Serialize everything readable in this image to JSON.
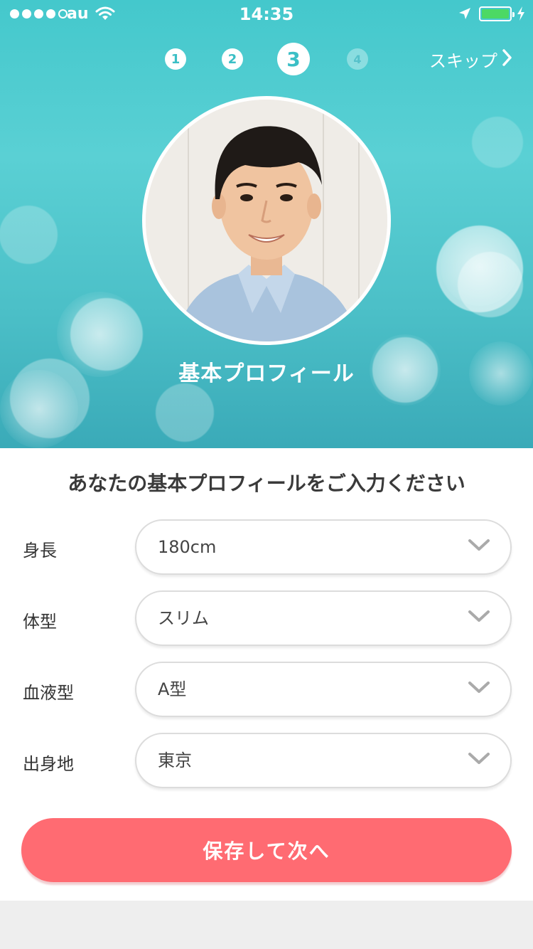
{
  "status_bar": {
    "carrier": "au",
    "time": "14:35",
    "signal_dots_filled": 4,
    "battery_color": "#4cd964"
  },
  "steps": [
    {
      "label": "1",
      "state": "done"
    },
    {
      "label": "2",
      "state": "done"
    },
    {
      "label": "3",
      "state": "current"
    },
    {
      "label": "4",
      "state": "todo"
    }
  ],
  "skip": {
    "label": "スキップ"
  },
  "hero": {
    "title": "基本プロフィール"
  },
  "form": {
    "heading": "あなたの基本プロフィールをご入力ください",
    "fields": [
      {
        "label": "身長",
        "value": "180cm"
      },
      {
        "label": "体型",
        "value": "スリム"
      },
      {
        "label": "血液型",
        "value": "A型"
      },
      {
        "label": "出身地",
        "value": "東京"
      }
    ],
    "submit_label": "保存して次へ"
  },
  "colors": {
    "accent": "#3bbfc6",
    "button": "#ff6b72"
  }
}
